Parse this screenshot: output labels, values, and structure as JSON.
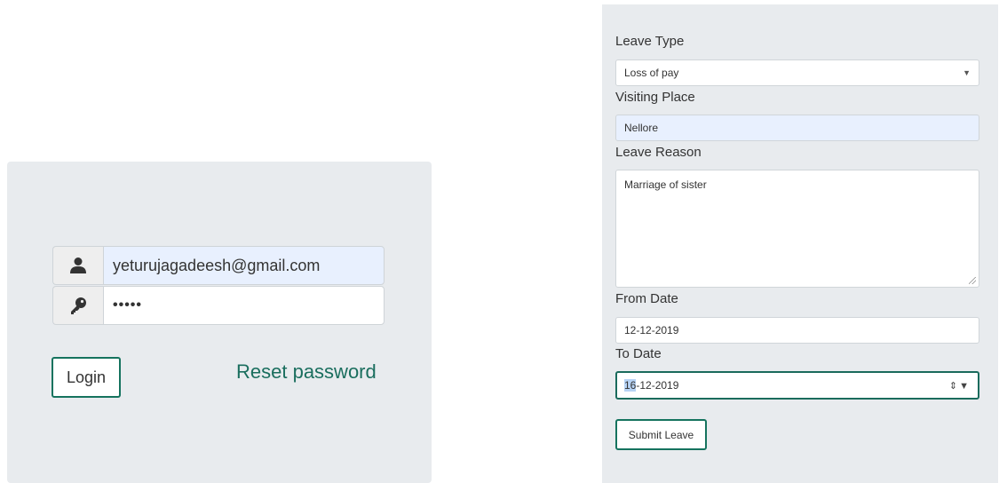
{
  "login": {
    "username_value": "yeturujagadeesh@gmail.com",
    "password_value": "•••••",
    "login_label": "Login",
    "reset_label": "Reset password",
    "icons": [
      "user-icon",
      "key-icon"
    ]
  },
  "leave_form": {
    "leave_type_label": "Leave Type",
    "leave_type_value": "Loss of pay",
    "visiting_place_label": "Visiting Place",
    "visiting_place_value": "Nellore",
    "leave_reason_label": "Leave Reason",
    "leave_reason_value": "Marriage of sister",
    "from_date_label": "From Date",
    "from_date_value": "12-12-2019",
    "to_date_label": "To Date",
    "to_date_day": "16",
    "to_date_rest": "-12-2019",
    "submit_label": "Submit Leave"
  },
  "colors": {
    "panel_bg": "#e8ebee",
    "accent": "#15735e",
    "autofill_bg": "#e8f0fe"
  }
}
